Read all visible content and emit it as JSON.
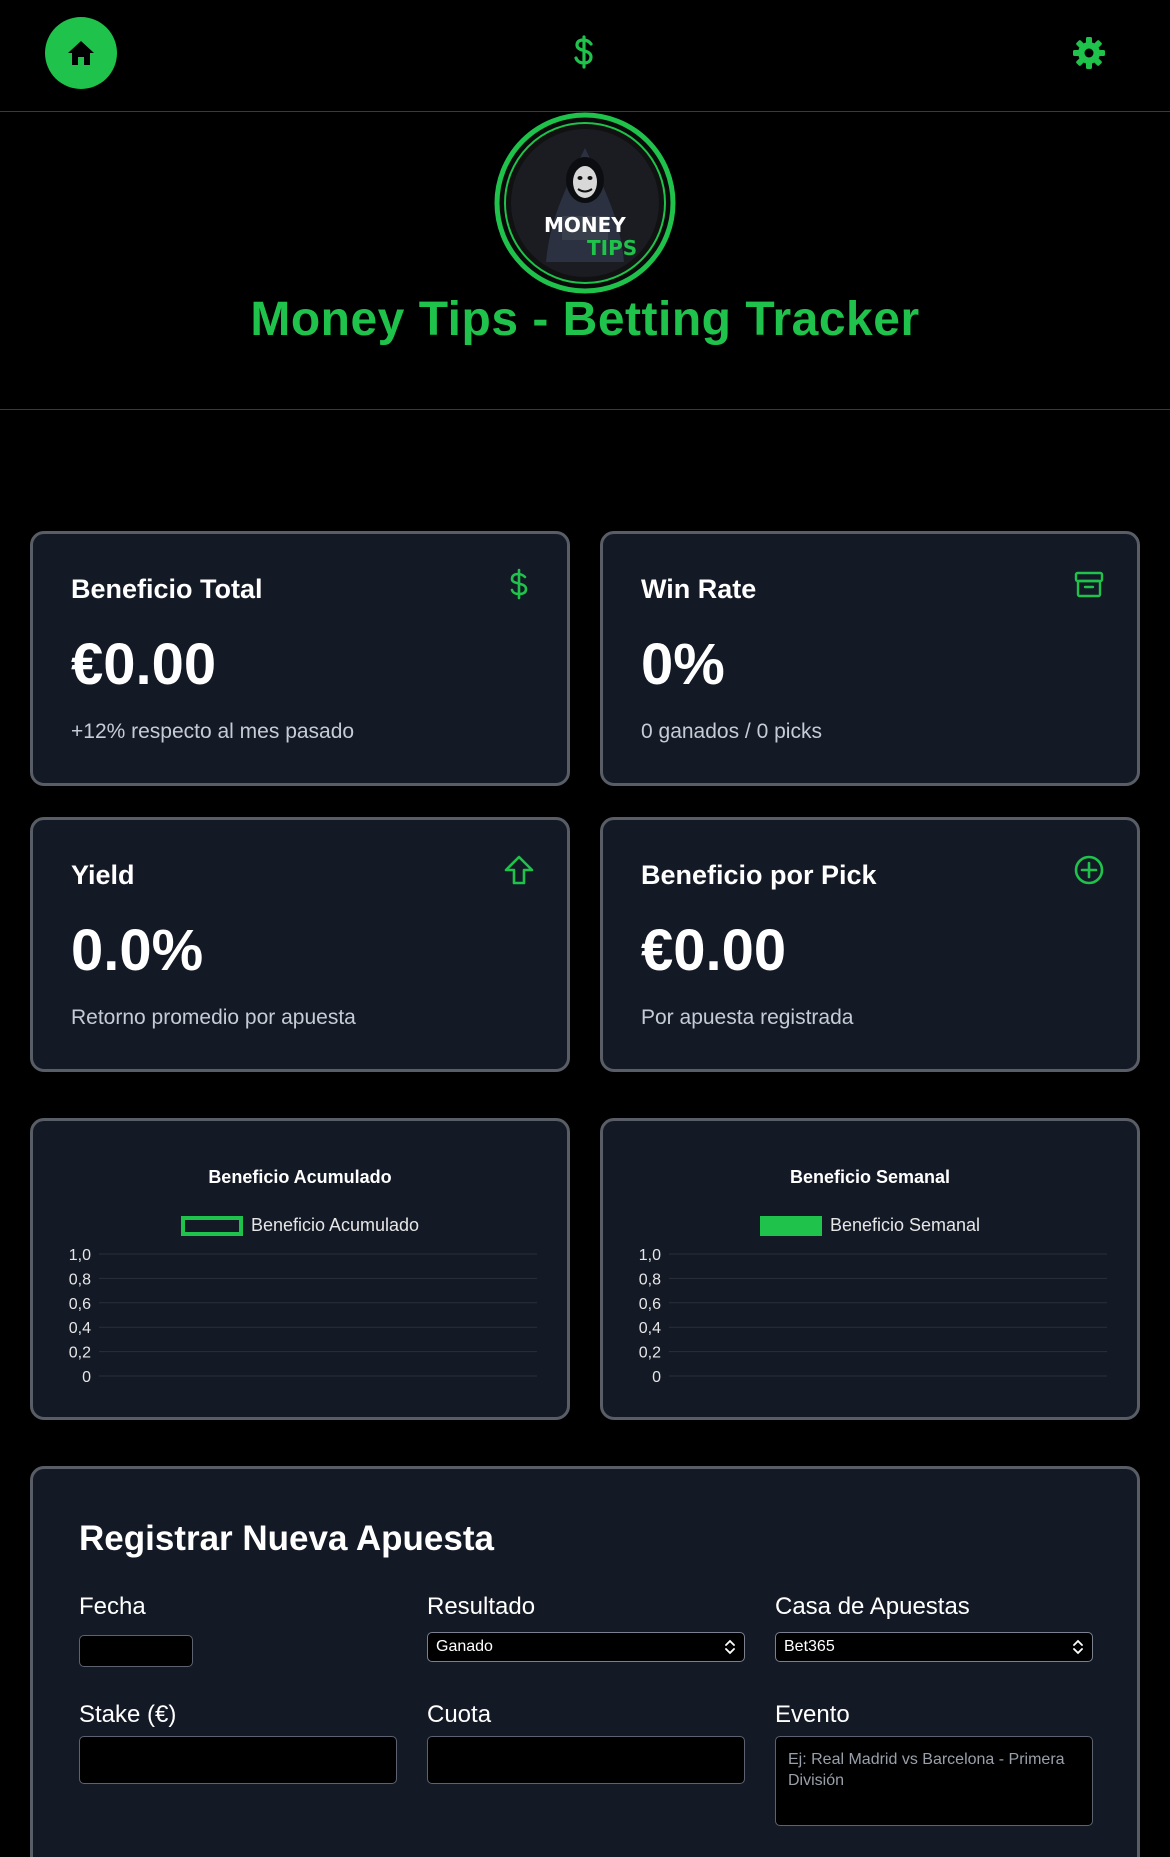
{
  "nav": {
    "home_icon": "home-icon",
    "dollar_icon": "dollar-icon",
    "settings_icon": "gear-icon",
    "accent": "#1fc24a"
  },
  "header": {
    "logo_text_top": "MONEY",
    "logo_text_bottom": "TIPS",
    "title": "Money Tips - Betting Tracker"
  },
  "stats": [
    {
      "title": "Beneficio Total",
      "value": "€0.00",
      "sub": "+12% respecto al mes pasado",
      "icon": "dollar-icon"
    },
    {
      "title": "Win Rate",
      "value": "0%",
      "sub": "0 ganados / 0 picks",
      "icon": "archive-icon"
    },
    {
      "title": "Yield",
      "value": "0.0%",
      "sub": "Retorno promedio por apuesta",
      "icon": "arrow-up-icon"
    },
    {
      "title": "Beneficio por Pick",
      "value": "€0.00",
      "sub": "Por apuesta registrada",
      "icon": "plus-circle-icon"
    }
  ],
  "chart_data": [
    {
      "type": "line",
      "title": "Beneficio Acumulado",
      "series": [
        {
          "name": "Beneficio Acumulado",
          "values": []
        }
      ],
      "categories": [],
      "ylim": [
        0,
        1.0
      ],
      "yticks": [
        "1,0",
        "0,8",
        "0,6",
        "0,4",
        "0,2",
        "0"
      ],
      "grid": true,
      "legend": "top"
    },
    {
      "type": "bar",
      "title": "Beneficio Semanal",
      "series": [
        {
          "name": "Beneficio Semanal",
          "values": []
        }
      ],
      "categories": [],
      "ylim": [
        0,
        1.0
      ],
      "yticks": [
        "1,0",
        "0,8",
        "0,6",
        "0,4",
        "0,2",
        "0"
      ],
      "grid": true,
      "legend": "top"
    }
  ],
  "form": {
    "title": "Registrar Nueva Apuesta",
    "fecha_label": "Fecha",
    "resultado_label": "Resultado",
    "resultado_value": "Ganado",
    "casa_label": "Casa de Apuestas",
    "casa_value": "Bet365",
    "stake_label": "Stake (€)",
    "cuota_label": "Cuota",
    "evento_label": "Evento",
    "evento_placeholder": "Ej: Real Madrid vs Barcelona - Primera División"
  }
}
